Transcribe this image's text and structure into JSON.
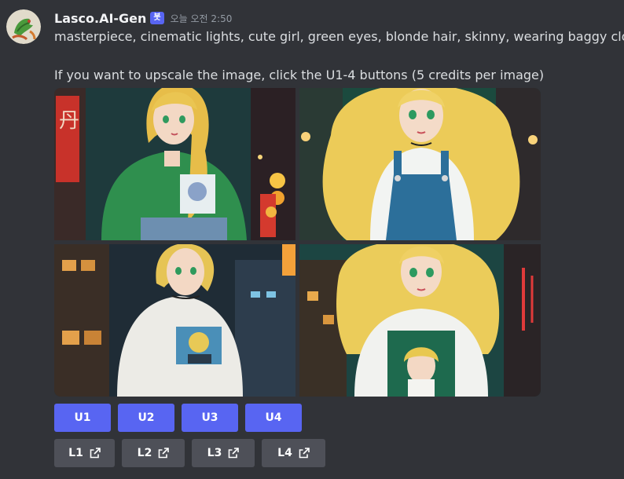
{
  "message": {
    "author": "Lasco.AI-Gen",
    "bot_tag": "봇",
    "timestamp": "오늘 오전 2:50",
    "prompt_text": "masterpiece, cinematic lights, cute girl, green eyes, blonde hair, skinny, wearing baggy clothes -",
    "info_text": "If you want to upscale the image, click the U1-4 buttons  (5 credits per image)"
  },
  "upscale_buttons": [
    "U1",
    "U2",
    "U3",
    "U4"
  ],
  "link_buttons": [
    "L1",
    "L2",
    "L3",
    "L4"
  ],
  "colors": {
    "background": "#313338",
    "accent": "#5865f2",
    "secondary_button": "#4e5058"
  },
  "icons": {
    "link_buttons": "external-link-icon"
  }
}
